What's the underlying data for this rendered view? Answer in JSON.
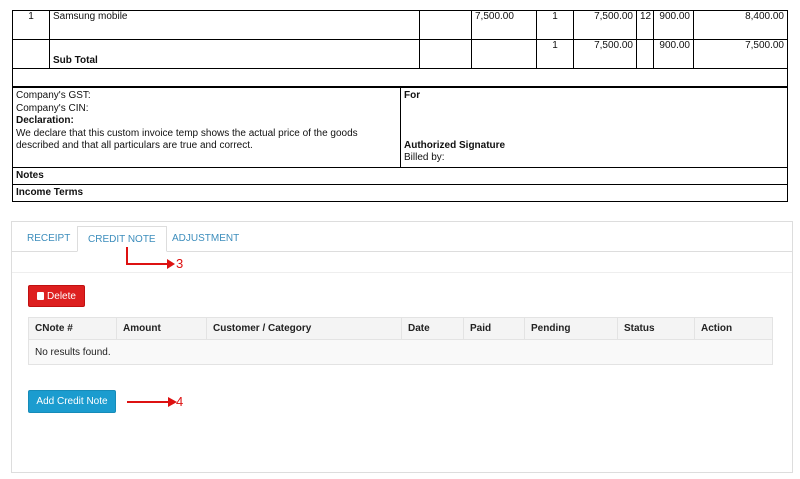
{
  "invoice": {
    "item_row": {
      "sno": "1",
      "description": "Samsung mobile",
      "rate": "7,500.00",
      "qty": "1",
      "amount": "7,500.00",
      "tax_rate": "12",
      "tax": "900.00",
      "total": "8,400.00"
    },
    "subtotal_row": {
      "label": "Sub Total",
      "qty": "1",
      "amount": "7,500.00",
      "tax": "900.00",
      "total": "7,500.00"
    },
    "company_gst_label": "Company's GST:",
    "company_cin_label": "Company's CIN:",
    "declaration_title": "Declaration:",
    "declaration_text": "We declare that this custom invoice temp shows the actual price of the goods described and that all particulars are true and correct.",
    "for_label": "For",
    "signature_label": "Authorized Signature",
    "billed_by_label": "Billed by:",
    "notes_label": "Notes",
    "income_terms_label": "Income Terms"
  },
  "tabs": [
    {
      "label": "RECEIPT",
      "active": false
    },
    {
      "label": "CREDIT NOTE",
      "active": true
    },
    {
      "label": "ADJUSTMENT",
      "active": false
    }
  ],
  "delete_button": {
    "label": "Delete",
    "icon": "trash-icon",
    "color": "#dd1f1f"
  },
  "credit_table": {
    "columns": [
      "CNote #",
      "Amount",
      "Customer / Category",
      "Date",
      "Paid",
      "Pending",
      "Status",
      "Action"
    ],
    "empty_message": "No results found."
  },
  "add_button": {
    "label": "Add Credit Note",
    "color": "#1b9ccf"
  },
  "annotations": [
    {
      "number": "3",
      "color": "#dd1111"
    },
    {
      "number": "4",
      "color": "#dd1111"
    }
  ]
}
